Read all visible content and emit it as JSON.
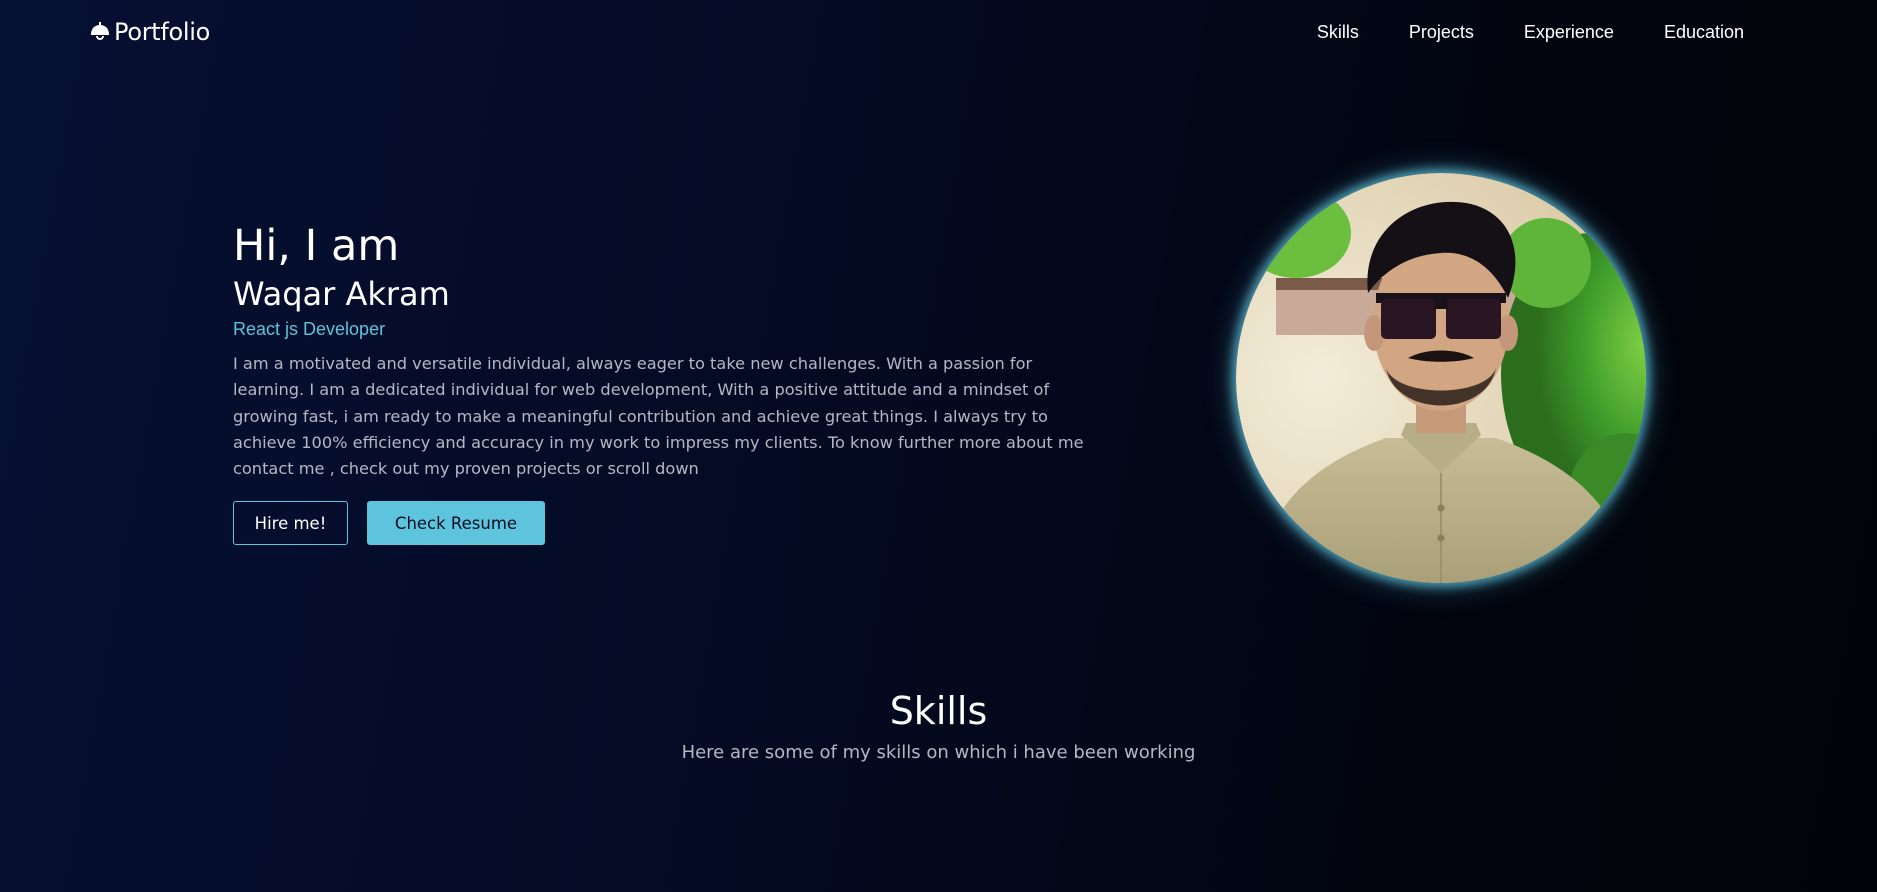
{
  "brand": {
    "icon": "lamp-icon",
    "name": "Portfolio"
  },
  "nav": {
    "items": [
      {
        "label": "Skills"
      },
      {
        "label": "Projects"
      },
      {
        "label": "Experience"
      },
      {
        "label": "Education"
      }
    ]
  },
  "hero": {
    "greeting": "Hi, I am",
    "name": "Waqar Akram",
    "role": "React js Developer",
    "bio": "I am a motivated and versatile individual, always eager to take new challenges. With a passion for learning. I am a dedicated individual for web development, With a positive attitude and a mindset of growing fast, i am ready to make a meaningful contribution and achieve great things. I always try to achieve 100% efficiency and accuracy in my work to impress my clients. To know further more about me contact me , check out my proven projects or scroll down",
    "hire_label": "Hire me!",
    "resume_label": "Check Resume"
  },
  "skills": {
    "title": "Skills",
    "subtitle": "Here are some of my skills on which i have been working"
  },
  "colors": {
    "accent": "#5ec3dd",
    "background": "#040a22",
    "muted_text": "#b4b8c4"
  }
}
